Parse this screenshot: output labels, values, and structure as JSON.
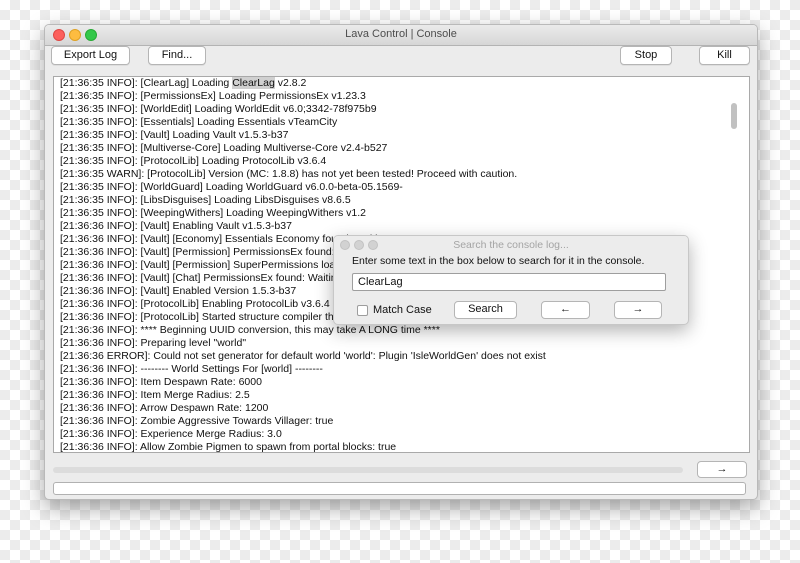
{
  "window": {
    "title": "Lava Control | Console"
  },
  "toolbar": {
    "export_label": "Export Log",
    "find_label": "Find...",
    "stop_label": "Stop",
    "kill_label": "Kill"
  },
  "log": [
    "[21:36:35 INFO]: [ClearLag] Loading ClearLag v2.8.2",
    "[21:36:35 INFO]: [PermissionsEx] Loading PermissionsEx v1.23.3",
    "[21:36:35 INFO]: [WorldEdit] Loading WorldEdit v6.0;3342-78f975b9",
    "[21:36:35 INFO]: [Essentials] Loading Essentials vTeamCity",
    "[21:36:35 INFO]: [Vault] Loading Vault v1.5.3-b37",
    "[21:36:35 INFO]: [Multiverse-Core] Loading Multiverse-Core v2.4-b527",
    "[21:36:35 INFO]: [ProtocolLib] Loading ProtocolLib v3.6.4",
    "[21:36:35 WARN]: [ProtocolLib] Version (MC: 1.8.8) has not yet been tested! Proceed with caution.",
    "[21:36:35 INFO]: [WorldGuard] Loading WorldGuard v6.0.0-beta-05.1569-",
    "[21:36:35 INFO]: [LibsDisguises] Loading LibsDisguises v8.6.5",
    "[21:36:35 INFO]: [WeepingWithers] Loading WeepingWithers v1.2",
    "[21:36:36 INFO]: [Vault] Enabling Vault v1.5.3-b37",
    "[21:36:36 INFO]: [Vault] [Economy] Essentials Economy found: Waiting",
    "[21:36:36 INFO]: [Vault] [Permission] PermissionsEx found: Waiting",
    "[21:36:36 INFO]: [Vault] [Permission] SuperPermissions loaded as backup permission system.",
    "[21:36:36 INFO]: [Vault] [Chat] PermissionsEx found: Waiting",
    "[21:36:36 INFO]: [Vault] Enabled Version 1.5.3-b37",
    "[21:36:36 INFO]: [ProtocolLib] Enabling ProtocolLib v3.6.4",
    "[21:36:36 INFO]: [ProtocolLib] Started structure compiler thread.",
    "[21:36:36 INFO]: **** Beginning UUID conversion, this may take A LONG time ****",
    "[21:36:36 INFO]: Preparing level \"world\"",
    "[21:36:36 ERROR]: Could not set generator for default world 'world': Plugin 'IsleWorldGen' does not exist",
    "[21:36:36 INFO]: -------- World Settings For [world] --------",
    "[21:36:36 INFO]: Item Despawn Rate: 6000",
    "[21:36:36 INFO]: Item Merge Radius: 2.5",
    "[21:36:36 INFO]: Arrow Despawn Rate: 1200",
    "[21:36:36 INFO]: Zombie Aggressive Towards Villager: true",
    "[21:36:36 INFO]: Experience Merge Radius: 3.0",
    "[21:36:36 INFO]: Allow Zombie Pigmen to spawn from portal blocks: true"
  ],
  "highlight": {
    "pre": "[21:36:35 INFO]: [ClearLag] Loading ",
    "match": "ClearLag",
    "post": " v2.8.2"
  },
  "send_label": "→",
  "search": {
    "title": "Search the console log...",
    "prompt": "Enter some text in the box below to search for it in the console.",
    "value": "ClearLag",
    "match_case_label": "Match Case",
    "search_label": "Search",
    "prev_label": "←",
    "next_label": "→"
  }
}
